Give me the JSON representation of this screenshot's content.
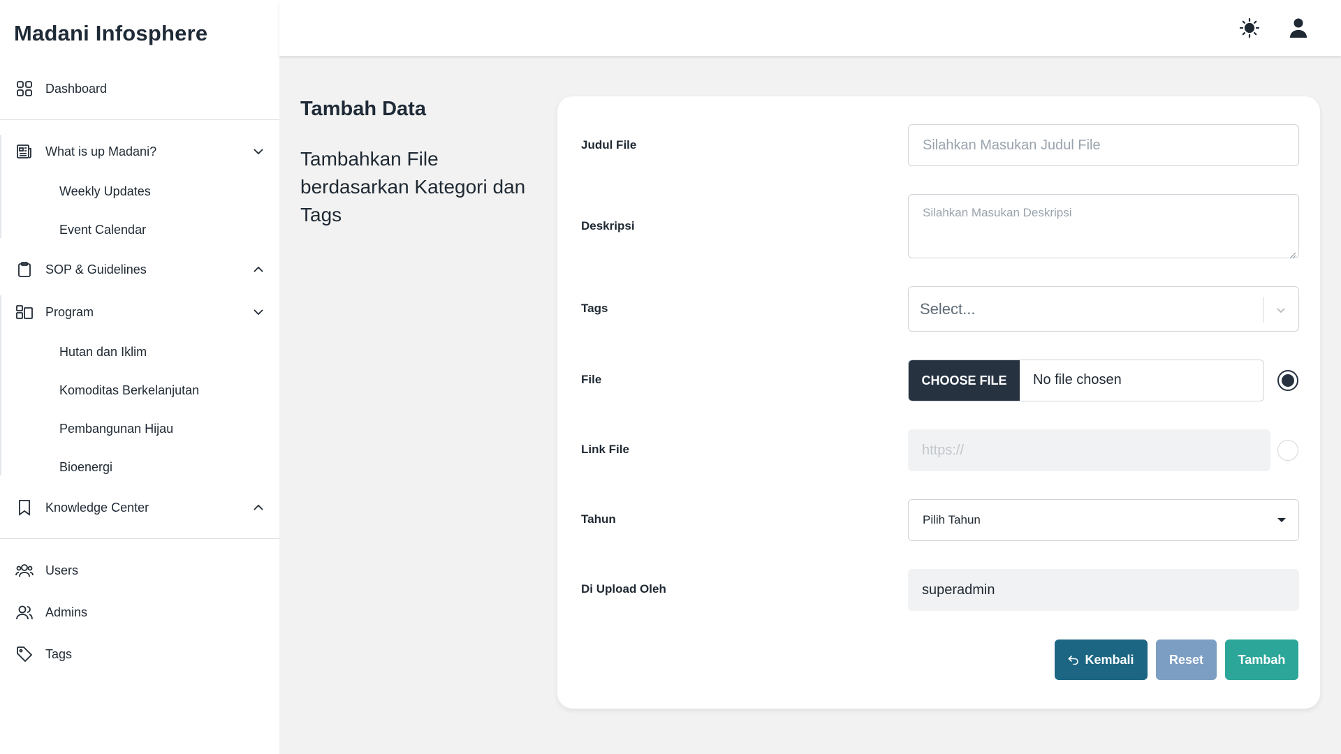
{
  "app": {
    "title": "Madani Infosphere"
  },
  "sidebar": {
    "dashboard": "Dashboard",
    "whats_up": "What is up Madani?",
    "weekly_updates": "Weekly Updates",
    "event_calendar": "Event Calendar",
    "sop": "SOP & Guidelines",
    "program": "Program",
    "hutan": "Hutan dan Iklim",
    "komoditas": "Komoditas Berkelanjutan",
    "pembangunan": "Pembangunan Hijau",
    "bioenergi": "Bioenergi",
    "knowledge": "Knowledge Center",
    "users": "Users",
    "admins": "Admins",
    "tags": "Tags"
  },
  "page": {
    "title": "Tambah Data",
    "description": "Tambahkan File berdasarkan Kategori dan Tags"
  },
  "form": {
    "judul_label": "Judul File",
    "judul_placeholder": "Silahkan Masukan Judul File",
    "deskripsi_label": "Deskripsi",
    "deskripsi_placeholder": "Silahkan Masukan Deskripsi",
    "tags_label": "Tags",
    "tags_placeholder": "Select...",
    "file_label": "File",
    "file_button": "CHOOSE FILE",
    "file_status": "No file chosen",
    "link_label": "Link File",
    "link_placeholder": "https://",
    "tahun_label": "Tahun",
    "tahun_value": "Pilih Tahun",
    "upload_label": "Di Upload Oleh",
    "upload_value": "superadmin"
  },
  "buttons": {
    "back": "Kembali",
    "reset": "Reset",
    "add": "Tambah"
  },
  "colors": {
    "back": "#1c6683",
    "reset": "#7d9ec3",
    "add": "#2da69a",
    "dark": "#263240"
  },
  "icons": {
    "theme": "sun-icon",
    "user": "user-icon"
  }
}
